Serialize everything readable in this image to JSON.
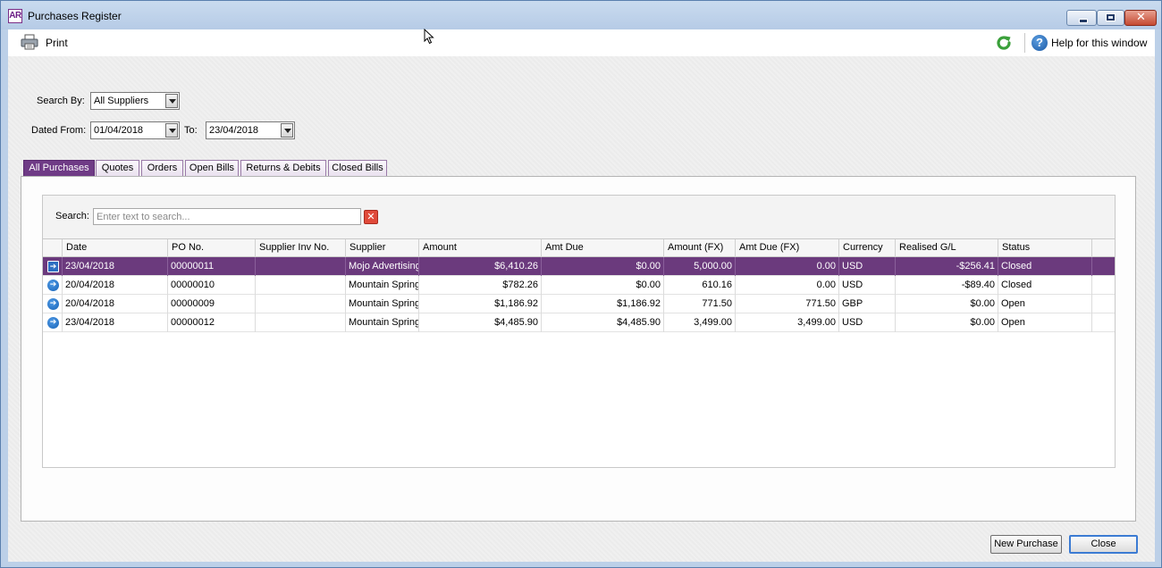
{
  "window": {
    "app_icon": "AR",
    "title": "Purchases Register",
    "controls": {
      "minimize": "minimize-icon",
      "maximize": "maximize-icon",
      "close": "✕"
    }
  },
  "toolbar": {
    "print_label": "Print",
    "print_icon": "printer-icon",
    "refresh_icon": "refresh-icon",
    "help_icon": "?",
    "help_label": "Help for this window"
  },
  "filters": {
    "search_by_label": "Search By:",
    "search_by_value": "All Suppliers",
    "dated_from_label": "Dated From:",
    "dated_from_value": "01/04/2018",
    "to_label": "To:",
    "to_value": "23/04/2018"
  },
  "tabs": [
    {
      "label": "All Purchases",
      "active": true
    },
    {
      "label": "Quotes",
      "active": false
    },
    {
      "label": "Orders",
      "active": false
    },
    {
      "label": "Open Bills",
      "active": false
    },
    {
      "label": "Returns & Debits",
      "active": false
    },
    {
      "label": "Closed Bills",
      "active": false
    }
  ],
  "search": {
    "label": "Search:",
    "placeholder": "Enter text to search...",
    "clear": "✕"
  },
  "table": {
    "columns": [
      "Date",
      "PO No.",
      "Supplier Inv No.",
      "Supplier",
      "Amount",
      "Amt Due",
      "Amount (FX)",
      "Amt Due (FX)",
      "Currency",
      "Realised G/L",
      "Status"
    ],
    "rows": [
      {
        "selected": true,
        "date": "23/04/2018",
        "po": "00000011",
        "supinv": "",
        "supplier": "Mojo Advertising",
        "amount": "$6,410.26",
        "amtdue": "$0.00",
        "amountfx": "5,000.00",
        "amtduefx": "0.00",
        "currency": "USD",
        "realised": "-$256.41",
        "status": "Closed"
      },
      {
        "selected": false,
        "date": "20/04/2018",
        "po": "00000010",
        "supinv": "",
        "supplier": "Mountain Springs",
        "amount": "$782.26",
        "amtdue": "$0.00",
        "amountfx": "610.16",
        "amtduefx": "0.00",
        "currency": "USD",
        "realised": "-$89.40",
        "status": "Closed"
      },
      {
        "selected": false,
        "date": "20/04/2018",
        "po": "00000009",
        "supinv": "",
        "supplier": "Mountain Springs",
        "amount": "$1,186.92",
        "amtdue": "$1,186.92",
        "amountfx": "771.50",
        "amtduefx": "771.50",
        "currency": "GBP",
        "realised": "$0.00",
        "status": "Open"
      },
      {
        "selected": false,
        "date": "23/04/2018",
        "po": "00000012",
        "supinv": "",
        "supplier": "Mountain Springs",
        "amount": "$4,485.90",
        "amtdue": "$4,485.90",
        "amountfx": "3,499.00",
        "amtduefx": "3,499.00",
        "currency": "USD",
        "realised": "$0.00",
        "status": "Open"
      }
    ]
  },
  "buttons": {
    "new_purchase": "New Purchase",
    "close": "Close"
  },
  "colors": {
    "accent": "#6b3a7d",
    "titlebar": "#c9dbef",
    "close_button": "#c54a32"
  }
}
